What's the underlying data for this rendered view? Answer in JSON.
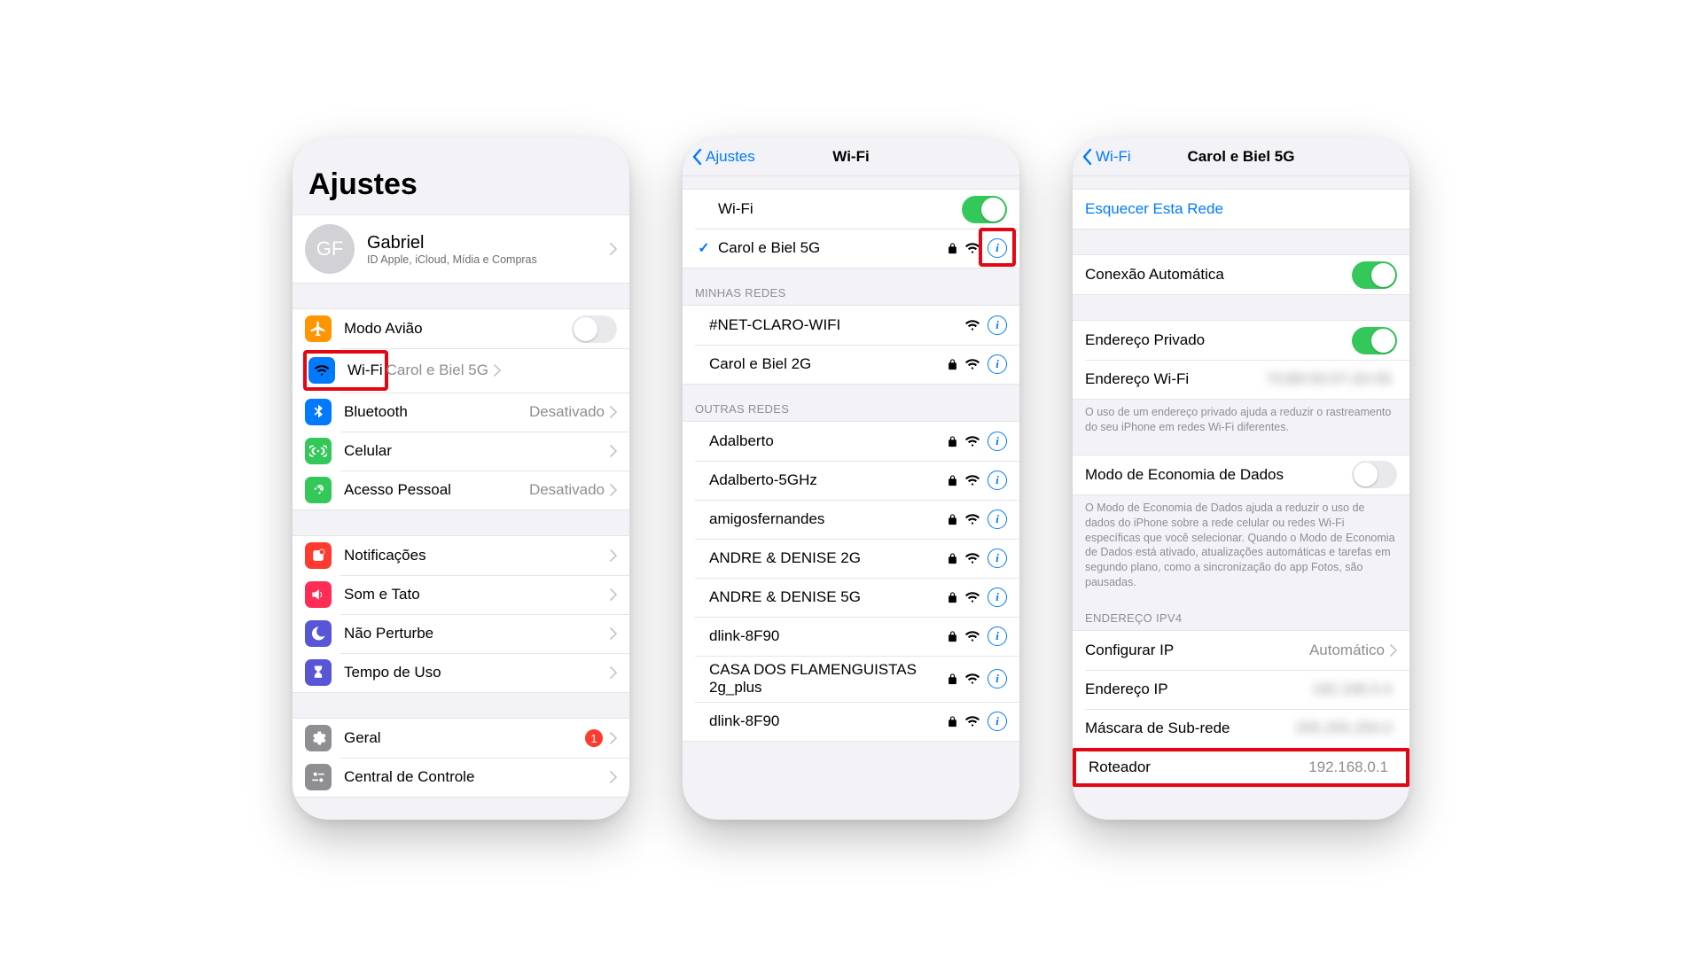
{
  "colors": {
    "orange": "#ff9500",
    "blue": "#007aff",
    "blue2": "#0a84ff",
    "green": "#34c759",
    "red": "#ff3b30",
    "purple": "#5856d6",
    "pink": "#ff2d55",
    "gray": "#8e8e93",
    "indigo": "#5e5ce6"
  },
  "screen1": {
    "title": "Ajustes",
    "profile": {
      "initials": "GF",
      "name": "Gabriel",
      "sub": "ID Apple, iCloud, Mídia e Compras"
    },
    "rows1": [
      {
        "key": "airplane",
        "label": "Modo Avião",
        "type": "switch",
        "on": false,
        "iconBg": "#ff9500"
      },
      {
        "key": "wifi",
        "label": "Wi-Fi",
        "value": "Carol e Biel 5G",
        "iconBg": "#007aff",
        "highlight": true
      },
      {
        "key": "bluetooth",
        "label": "Bluetooth",
        "value": "Desativado",
        "iconBg": "#007aff"
      },
      {
        "key": "cellular",
        "label": "Celular",
        "iconBg": "#34c759"
      },
      {
        "key": "hotspot",
        "label": "Acesso Pessoal",
        "value": "Desativado",
        "iconBg": "#34c759"
      }
    ],
    "rows2": [
      {
        "key": "notifications",
        "label": "Notificações",
        "iconBg": "#ff3b30"
      },
      {
        "key": "sounds",
        "label": "Som e Tato",
        "iconBg": "#ff2d55"
      },
      {
        "key": "dnd",
        "label": "Não Perturbe",
        "iconBg": "#5856d6"
      },
      {
        "key": "screentime",
        "label": "Tempo de Uso",
        "iconBg": "#5856d6"
      }
    ],
    "rows3": [
      {
        "key": "general",
        "label": "Geral",
        "iconBg": "#8e8e93",
        "badge": "1"
      },
      {
        "key": "controlcenter",
        "label": "Central de Controle",
        "iconBg": "#8e8e93"
      }
    ]
  },
  "screen2": {
    "back": "Ajustes",
    "title": "Wi-Fi",
    "toggleLabel": "Wi-Fi",
    "toggleOn": true,
    "connected": {
      "name": "Carol e Biel 5G",
      "locked": true,
      "highlightInfo": true
    },
    "myHeader": "MINHAS REDES",
    "myNetworks": [
      {
        "name": "#NET-CLARO-WIFI",
        "locked": false
      },
      {
        "name": "Carol e Biel 2G",
        "locked": true
      }
    ],
    "otherHeader": "OUTRAS REDES",
    "otherNetworks": [
      {
        "name": "Adalberto",
        "locked": true
      },
      {
        "name": "Adalberto-5GHz",
        "locked": true
      },
      {
        "name": "amigosfernandes",
        "locked": true
      },
      {
        "name": "ANDRE & DENISE 2G",
        "locked": true
      },
      {
        "name": "ANDRE & DENISE 5G",
        "locked": true
      },
      {
        "name": "dlink-8F90",
        "locked": true
      },
      {
        "name": "CASA DOS FLAMENGUISTAS 2g_plus",
        "locked": true
      },
      {
        "name": "dlink-8F90",
        "locked": true
      }
    ]
  },
  "screen3": {
    "back": "Wi-Fi",
    "title": "Carol e Biel 5G",
    "forget": "Esquecer Esta Rede",
    "autoJoinLabel": "Conexão Automática",
    "autoJoinOn": true,
    "privAddrLabel": "Endereço Privado",
    "privAddrOn": true,
    "wifiAddrLabel": "Endereço Wi-Fi",
    "wifiAddrValue": "70:B9:50:07:2D:55",
    "privNote": "O uso de um endereço privado ajuda a reduzir o rastreamento do seu iPhone em redes Wi-Fi diferentes.",
    "lowDataLabel": "Modo de Economia de Dados",
    "lowDataOn": false,
    "lowDataNote": "O Modo de Economia de Dados ajuda a reduzir o uso de dados do iPhone sobre a rede celular ou redes Wi-Fi específicas que você selecionar. Quando o Modo de Economia de Dados está ativado, atualizações automáticas e tarefas em segundo plano, como a sincronização do app Fotos, são pausadas.",
    "ipv4Header": "ENDEREÇO IPV4",
    "ipv4": [
      {
        "label": "Configurar IP",
        "value": "Automático",
        "chevron": true
      },
      {
        "label": "Endereço IP",
        "value": "192.168.0.4",
        "blur": true
      },
      {
        "label": "Máscara de Sub-rede",
        "value": "255.255.255.0",
        "blur": true
      },
      {
        "label": "Roteador",
        "value": "192.168.0.1",
        "highlight": true
      }
    ]
  }
}
